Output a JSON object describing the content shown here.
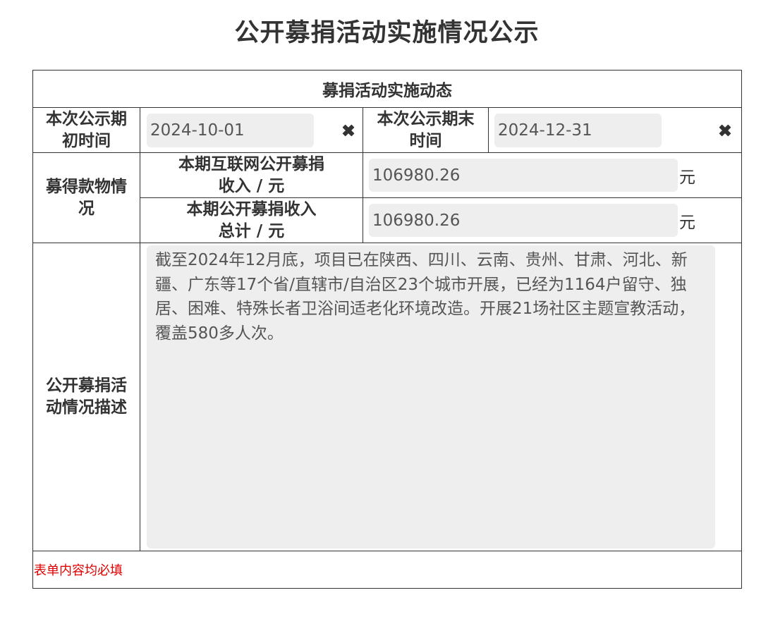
{
  "page": {
    "title": "公开募捐活动实施情况公示"
  },
  "form": {
    "section_title": "募捐活动实施动态",
    "period_start": {
      "label_line1": "本次公示期",
      "label_line2": "初时间",
      "value": "2024-10-01",
      "clear_icon": "close-x-icon"
    },
    "period_end": {
      "label_line1": "本次公示期末",
      "label_line2": "时间",
      "value": "2024-12-31",
      "clear_icon": "close-x-icon"
    },
    "donations": {
      "group_label_line1": "募得款物情",
      "group_label_line2": "况",
      "internet_income": {
        "label_line1": "本期互联网公开募捐",
        "label_line2": "收入 / 元",
        "value": "106980.26",
        "unit": "元"
      },
      "total_income": {
        "label_line1": "本期公开募捐收入",
        "label_line2": "总计 / 元",
        "value": "106980.26",
        "unit": "元"
      }
    },
    "description": {
      "label_line1": "公开募捐活",
      "label_line2": "动情况描述",
      "value": "截至2024年12月底，项目已在陕西、四川、云南、贵州、甘肃、河北、新疆、广东等17个省/直辖市/自治区23个城市开展，已经为1164户留守、独居、困难、特殊长者卫浴间适老化环境改造。开展21场社区主题宣教活动，覆盖580多人次。"
    },
    "required_note": "表单内容均必填"
  },
  "colors": {
    "text": "#333333",
    "input_bg": "#eeeeee",
    "required_note": "#e00000",
    "border": "#333333"
  }
}
